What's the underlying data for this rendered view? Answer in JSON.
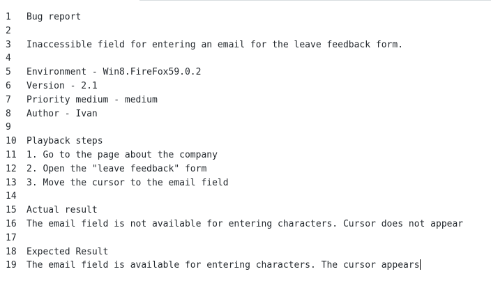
{
  "colors": {
    "text": "#24292e",
    "background": "#ffffff",
    "cursor": "#000000"
  },
  "editor": {
    "lines": [
      {
        "num": "1",
        "text": "Bug report"
      },
      {
        "num": "2",
        "text": ""
      },
      {
        "num": "3",
        "text": "Inaccessible field for entering an email for the leave feedback form."
      },
      {
        "num": "4",
        "text": ""
      },
      {
        "num": "5",
        "text": "Environment - Win8.FireFox59.0.2"
      },
      {
        "num": "6",
        "text": "Version - 2.1"
      },
      {
        "num": "7",
        "text": "Priority medium - medium"
      },
      {
        "num": "8",
        "text": "Author - Ivan"
      },
      {
        "num": "9",
        "text": ""
      },
      {
        "num": "10",
        "text": "Playback steps"
      },
      {
        "num": "11",
        "text": "1. Go to the page about the company"
      },
      {
        "num": "12",
        "text": "2. Open the \"leave feedback\" form"
      },
      {
        "num": "13",
        "text": "3. Move the cursor to the email field"
      },
      {
        "num": "14",
        "text": ""
      },
      {
        "num": "15",
        "text": "Actual result"
      },
      {
        "num": "16",
        "text": "The email field is not available for entering characters. Cursor does not appear"
      },
      {
        "num": "17",
        "text": ""
      },
      {
        "num": "18",
        "text": "Expected Result"
      },
      {
        "num": "19",
        "text": "The email field is available for entering characters. The cursor appears"
      }
    ]
  }
}
